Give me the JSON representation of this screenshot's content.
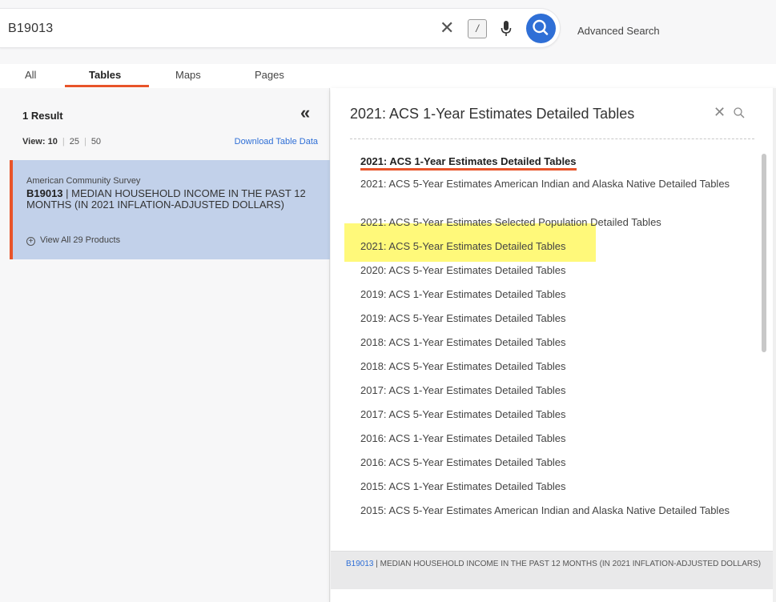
{
  "search": {
    "query": "B19013",
    "slash_key": "/",
    "advanced_label": "Advanced Search"
  },
  "tabs": [
    {
      "label": "All"
    },
    {
      "label": "Tables"
    },
    {
      "label": "Maps"
    },
    {
      "label": "Pages"
    }
  ],
  "results": {
    "count_label": "1 Result",
    "view_label": "View:",
    "view_options": [
      "10",
      "25",
      "50"
    ],
    "download_label": "Download Table Data"
  },
  "card": {
    "source": "American Community Survey",
    "code": "B19013",
    "separator": " | ",
    "title": "MEDIAN HOUSEHOLD INCOME IN THE PAST 12 MONTHS (IN 2021 INFLATION-ADJUSTED DOLLARS)",
    "products_label": "View All 29 Products"
  },
  "filter": {
    "title": "2021: ACS 1-Year Estimates Detailed Tables",
    "options": [
      "2021: ACS 1-Year Estimates Detailed Tables",
      "2021: ACS 5-Year Estimates American Indian and Alaska Native Detailed Tables",
      "2021: ACS 5-Year Estimates Selected Population Detailed Tables",
      "2021: ACS 5-Year Estimates Detailed Tables",
      "2020: ACS 5-Year Estimates Detailed Tables",
      "2019: ACS 1-Year Estimates Detailed Tables",
      "2019: ACS 5-Year Estimates Detailed Tables",
      "2018: ACS 1-Year Estimates Detailed Tables",
      "2018: ACS 5-Year Estimates Detailed Tables",
      "2017: ACS 1-Year Estimates Detailed Tables",
      "2017: ACS 5-Year Estimates Detailed Tables",
      "2016: ACS 1-Year Estimates Detailed Tables",
      "2016: ACS 5-Year Estimates Detailed Tables",
      "2015: ACS 1-Year Estimates Detailed Tables",
      "2015: ACS 5-Year Estimates American Indian and Alaska Native Detailed Tables"
    ]
  },
  "bottom": {
    "code": "B19013",
    "text": " | MEDIAN HOUSEHOLD INCOME IN THE PAST 12 MONTHS (IN 2021 INFLATION-ADJUSTED DOLLARS)"
  },
  "colors": {
    "accent": "#e8542a",
    "link": "#2f6fd6",
    "selected_card": "#c2d1ea",
    "highlight": "#fff646"
  },
  "icons": [
    "close-icon",
    "mic-icon",
    "search-icon",
    "double-chevron-left-icon",
    "plus-circle-icon"
  ]
}
